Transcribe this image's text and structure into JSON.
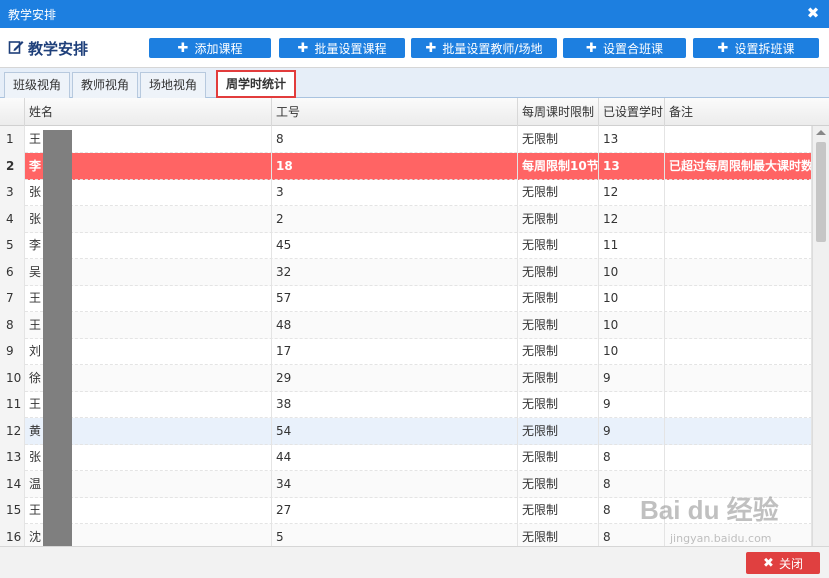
{
  "window": {
    "title": "教学安排",
    "close_glyph": "✖"
  },
  "page": {
    "title": "教学安排",
    "icon": "edit-icon"
  },
  "toolbar": {
    "buttons": [
      {
        "label": "添加课程"
      },
      {
        "label": "批量设置课程"
      },
      {
        "label": "批量设置教师/场地"
      },
      {
        "label": "设置合班课"
      },
      {
        "label": "设置拆班课"
      }
    ]
  },
  "tabs": [
    {
      "label": "班级视角"
    },
    {
      "label": "教师视角"
    },
    {
      "label": "场地视角"
    },
    {
      "label": "周学时统计"
    }
  ],
  "table": {
    "columns": [
      "姓名",
      "工号",
      "每周课时限制",
      "已设置学时",
      "备注"
    ],
    "rows": [
      {
        "n": "1",
        "name": "王",
        "id": "8",
        "limit": "无限制",
        "hours": "13",
        "note": ""
      },
      {
        "n": "2",
        "name": "李",
        "id": "18",
        "limit": "每周限制10节",
        "hours": "13",
        "note": "已超过每周限制最大课时数"
      },
      {
        "n": "3",
        "name": "张",
        "id": "3",
        "limit": "无限制",
        "hours": "12",
        "note": ""
      },
      {
        "n": "4",
        "name": "张",
        "id": "2",
        "limit": "无限制",
        "hours": "12",
        "note": ""
      },
      {
        "n": "5",
        "name": "李",
        "id": "45",
        "limit": "无限制",
        "hours": "11",
        "note": ""
      },
      {
        "n": "6",
        "name": "吴",
        "id": "32",
        "limit": "无限制",
        "hours": "10",
        "note": ""
      },
      {
        "n": "7",
        "name": "王",
        "id": "57",
        "limit": "无限制",
        "hours": "10",
        "note": ""
      },
      {
        "n": "8",
        "name": "王",
        "id": "48",
        "limit": "无限制",
        "hours": "10",
        "note": ""
      },
      {
        "n": "9",
        "name": "刘",
        "id": "17",
        "limit": "无限制",
        "hours": "10",
        "note": ""
      },
      {
        "n": "10",
        "name": "徐",
        "id": "29",
        "limit": "无限制",
        "hours": "9",
        "note": ""
      },
      {
        "n": "11",
        "name": "王",
        "id": "38",
        "limit": "无限制",
        "hours": "9",
        "note": ""
      },
      {
        "n": "12",
        "name": "黄",
        "id": "54",
        "limit": "无限制",
        "hours": "9",
        "note": ""
      },
      {
        "n": "13",
        "name": "张",
        "id": "44",
        "limit": "无限制",
        "hours": "8",
        "note": ""
      },
      {
        "n": "14",
        "name": "温",
        "id": "34",
        "limit": "无限制",
        "hours": "8",
        "note": ""
      },
      {
        "n": "15",
        "name": "王",
        "id": "27",
        "limit": "无限制",
        "hours": "8",
        "note": ""
      },
      {
        "n": "16",
        "name": "沈",
        "id": "5",
        "limit": "无限制",
        "hours": "8",
        "note": ""
      }
    ]
  },
  "footer": {
    "close_label": "关闭"
  },
  "watermark": {
    "brand": "Bai du 经验",
    "url": "jingyan.baidu.com"
  },
  "colors": {
    "primary": "#1d7fe0",
    "warn_row": "#ff6464",
    "close": "#e04040",
    "tab_highlight": "#e23c3c"
  }
}
